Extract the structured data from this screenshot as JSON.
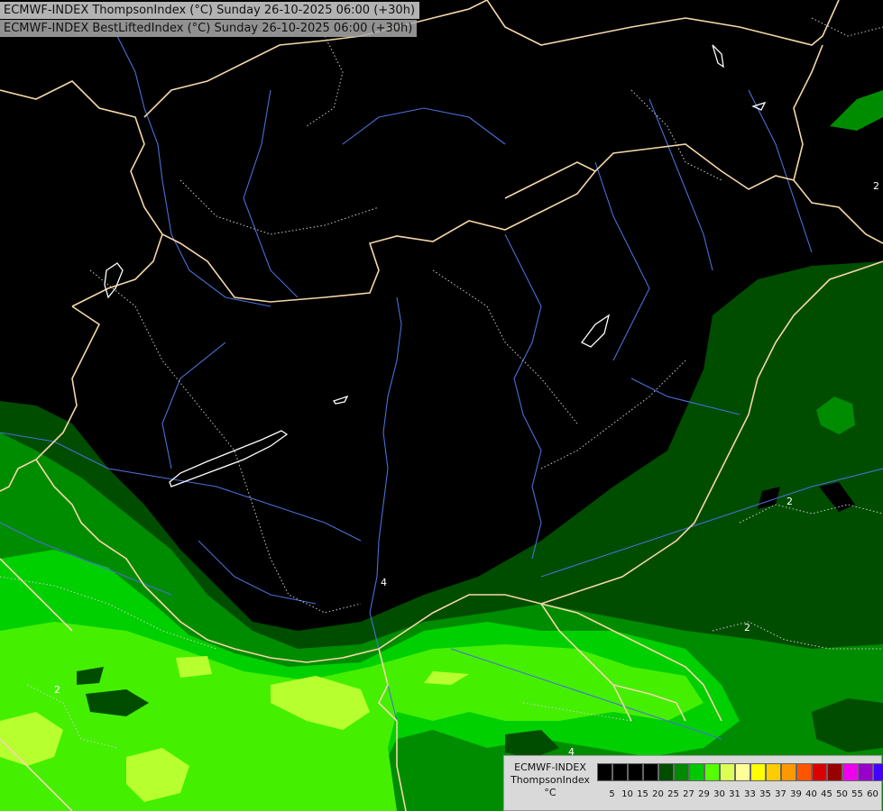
{
  "titles": {
    "line1": "ECMWF-INDEX ThompsonIndex (°C) Sunday 26-10-2025 06:00 (+30h)",
    "line2": "ECMWF-INDEX BestLiftedIndex (°C) Sunday 26-10-2025 06:00 (+30h)"
  },
  "legend": {
    "model": "ECMWF-INDEX",
    "param": "ThompsonIndex",
    "unit": "°C",
    "levels": [
      "5",
      "10",
      "15",
      "20",
      "25",
      "27",
      "29",
      "30",
      "31",
      "33",
      "35",
      "37",
      "39",
      "40",
      "45",
      "50",
      "55",
      "60"
    ],
    "colors": [
      "#000000",
      "#000000",
      "#000000",
      "#000000",
      "#004d00",
      "#008a00",
      "#00c800",
      "#55ff00",
      "#ddff55",
      "#ffff99",
      "#ffff00",
      "#ffcc00",
      "#ff9900",
      "#ff5500",
      "#dd0000",
      "#990000",
      "#ee00ee",
      "#9900cc",
      "#4400ff",
      "#0000ff"
    ]
  },
  "contour_labels": [
    "2",
    "2",
    "2",
    "2",
    "4",
    "4",
    "2"
  ],
  "colors": {
    "background": "#000000",
    "dark_green": "#004d00",
    "medium_green": "#008c00",
    "bright_green": "#00e000",
    "lime": "#55ff00",
    "yellow_green": "#bbff33",
    "border": "#f5d7a8",
    "river": "#4a6fd6"
  }
}
